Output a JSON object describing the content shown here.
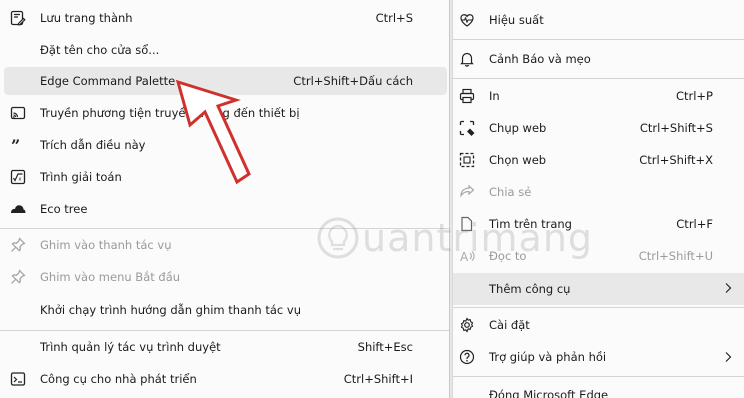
{
  "left_menu": {
    "items": [
      {
        "label": "Lưu trang thành",
        "shortcut": "Ctrl+S",
        "icon": "save-page-icon"
      },
      {
        "label": "Đặt tên cho cửa sổ...",
        "shortcut": "",
        "icon": ""
      },
      {
        "label": "Edge Command Palette",
        "shortcut": "Ctrl+Shift+Dấu cách",
        "icon": ""
      },
      {
        "label": "Truyền phương tiện truyền thông đến thiết bị",
        "shortcut": "",
        "icon": "cast-media-icon"
      },
      {
        "label": "Trích dẫn điều này",
        "shortcut": "",
        "icon": "quote-icon"
      },
      {
        "label": "Trình giải toán",
        "shortcut": "",
        "icon": "math-solver-icon"
      },
      {
        "label": "Eco tree",
        "shortcut": "",
        "icon": "eco-tree-icon"
      },
      {
        "label": "Ghim vào thanh tác vụ",
        "shortcut": "",
        "icon": "pin-icon"
      },
      {
        "label": "Ghim vào menu Bắt đầu",
        "shortcut": "",
        "icon": "pin-icon"
      },
      {
        "label": "Khởi chạy trình hướng dẫn ghim thanh tác vụ",
        "shortcut": "",
        "icon": ""
      },
      {
        "label": "Trình quản lý tác vụ trình duyệt",
        "shortcut": "Shift+Esc",
        "icon": ""
      },
      {
        "label": "Công cụ cho nhà phát triển",
        "shortcut": "Ctrl+Shift+I",
        "icon": "developer-tools-icon"
      }
    ]
  },
  "right_menu": {
    "items": [
      {
        "label": "Hiệu suất",
        "shortcut": "",
        "icon": "performance-heart-icon"
      },
      {
        "label": "Cảnh Báo và mẹo",
        "shortcut": "",
        "icon": "bell-icon"
      },
      {
        "label": "In",
        "shortcut": "Ctrl+P",
        "icon": "printer-icon"
      },
      {
        "label": "Chụp web",
        "shortcut": "Ctrl+Shift+S",
        "icon": "web-capture-icon"
      },
      {
        "label": "Chọn web",
        "shortcut": "Ctrl+Shift+X",
        "icon": "web-select-icon"
      },
      {
        "label": "Chia sẻ",
        "shortcut": "",
        "icon": "share-icon"
      },
      {
        "label": "Tìm trên trang",
        "shortcut": "Ctrl+F",
        "icon": "find-on-page-icon"
      },
      {
        "label": "Đọc to",
        "shortcut": "Ctrl+Shift+U",
        "icon": "read-aloud-icon"
      },
      {
        "label": "Thêm công cụ",
        "shortcut": "",
        "icon": ""
      },
      {
        "label": "Cài đặt",
        "shortcut": "",
        "icon": "gear-icon"
      },
      {
        "label": "Trợ giúp và phản hồi",
        "shortcut": "",
        "icon": "help-icon"
      },
      {
        "label": "Đóng Microsoft Edge",
        "shortcut": "",
        "icon": ""
      }
    ]
  },
  "watermark": {
    "text": "uantrimang"
  },
  "colors": {
    "arrow": "#d0312d",
    "highlight": "#e8e8e8",
    "panel": "#fbfbfb",
    "disabled": "#9a9a9a"
  }
}
